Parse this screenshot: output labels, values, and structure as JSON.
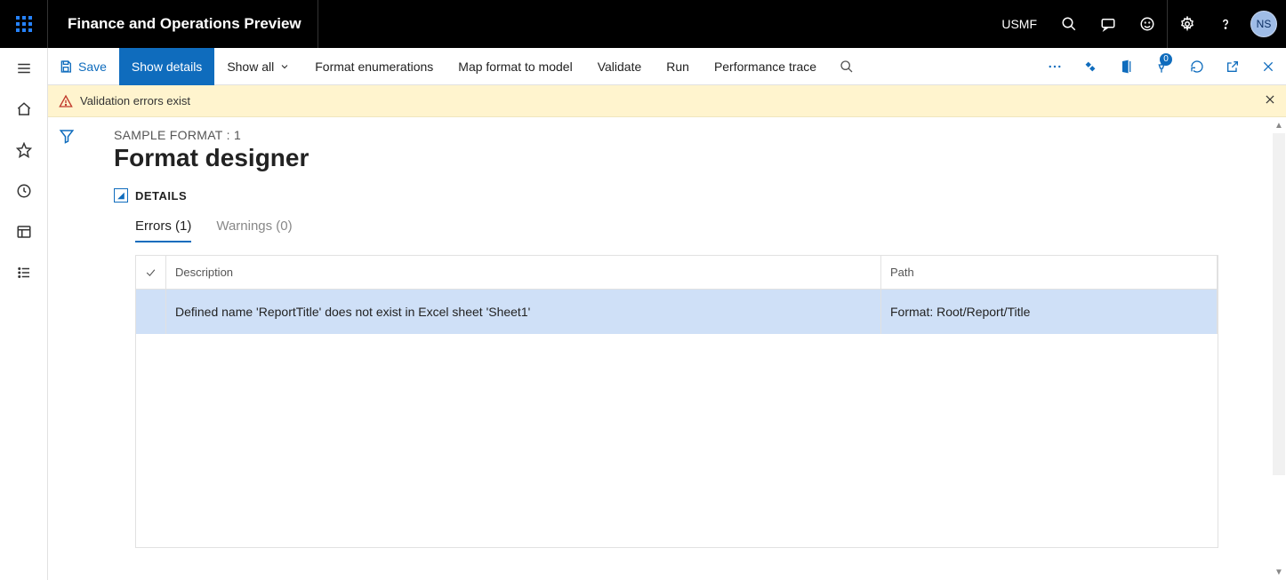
{
  "header": {
    "app_title": "Finance and Operations Preview",
    "company": "USMF",
    "avatar": "NS"
  },
  "toolbar": {
    "save": "Save",
    "show_details": "Show details",
    "show_all": "Show all",
    "format_enum": "Format enumerations",
    "map_format": "Map format to model",
    "validate": "Validate",
    "run": "Run",
    "perf_trace": "Performance trace",
    "badge_count": "0"
  },
  "warning": {
    "text": "Validation errors exist"
  },
  "page": {
    "breadcrumb": "SAMPLE FORMAT : 1",
    "title": "Format designer",
    "details_label": "DETAILS"
  },
  "tabs": {
    "errors": "Errors (1)",
    "warnings": "Warnings (0)"
  },
  "table": {
    "headers": {
      "description": "Description",
      "path": "Path"
    },
    "rows": [
      {
        "description": "Defined name 'ReportTitle' does not exist in Excel sheet 'Sheet1'",
        "path": "Format: Root/Report/Title"
      }
    ]
  }
}
